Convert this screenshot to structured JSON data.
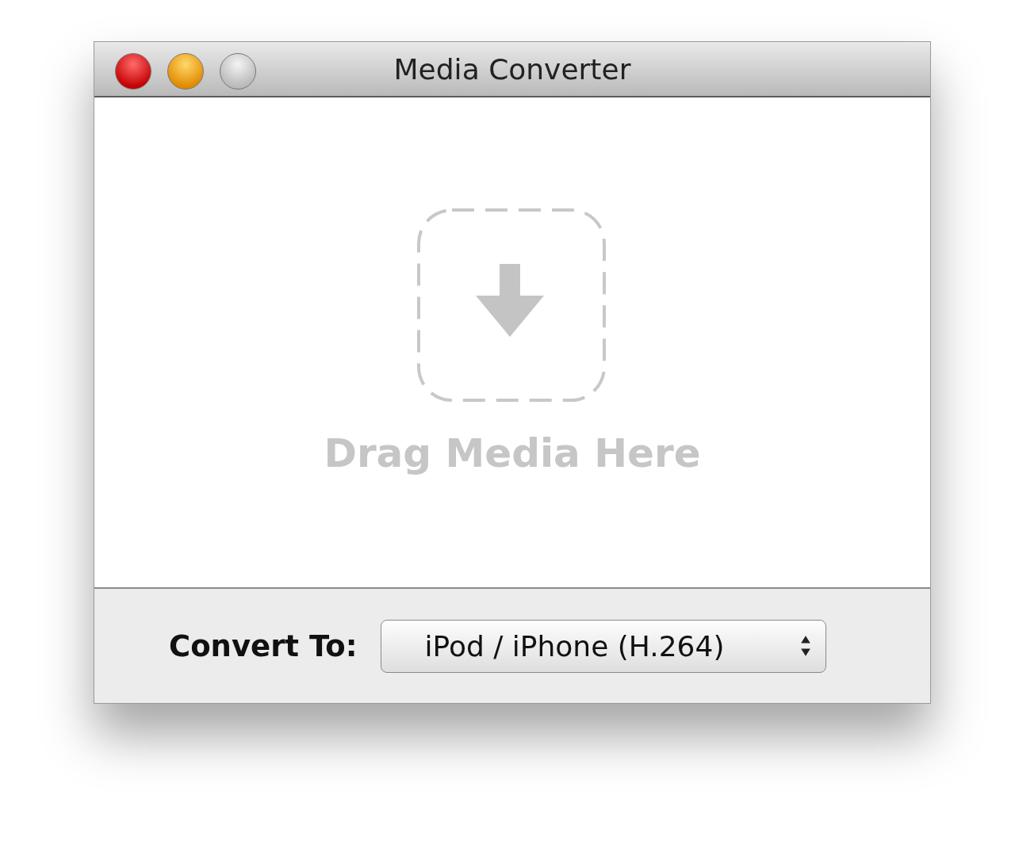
{
  "window": {
    "title": "Media Converter"
  },
  "window_buttons": [
    {
      "kind": "close",
      "disabled": false
    },
    {
      "kind": "minimize",
      "disabled": false
    },
    {
      "kind": "zoom",
      "disabled": true
    }
  ],
  "drop_zone": {
    "label": "Drag Media Here"
  },
  "convert_to": {
    "label": "Convert To:",
    "value": "iPod / iPhone (H.264)"
  }
}
